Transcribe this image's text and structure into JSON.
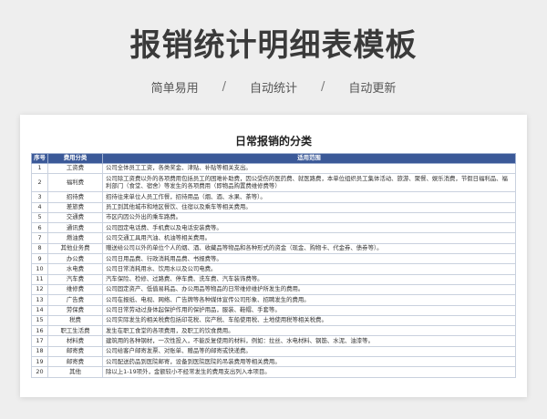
{
  "page": {
    "title": "报销统计明细表模板",
    "tagline": [
      "简单易用",
      "/",
      "自动统计",
      "/",
      "自动更新"
    ]
  },
  "sheet": {
    "title": "日常报销的分类",
    "headers": [
      "序号",
      "费用分类",
      "适用范围"
    ],
    "rows": [
      {
        "no": "1",
        "category": "工资费",
        "scope": "公司全体员工工资，各类奖金、津贴、补贴等相关支出。"
      },
      {
        "no": "2",
        "category": "福利费",
        "scope": "公司除工资费以外的各项费用包括员工的困难补助费，因公受伤的医药费、就医路费，本单位组织员工集体活动、旅游、聚餐、娱乐消费，节假日福利品、福利部门（食堂、宿舍）等发生的各项费用（即物品购置费维修费等）"
      },
      {
        "no": "3",
        "category": "招待费",
        "scope": "招待往来单位人员工作餐，招待用品（烟、酒、水果、茶等）。"
      },
      {
        "no": "4",
        "category": "差旅费",
        "scope": "员工到其他城市和地区餐饮、住宿以及乘车等相关费用。"
      },
      {
        "no": "5",
        "category": "交通费",
        "scope": "市区内因公外出的乘车路费。"
      },
      {
        "no": "6",
        "category": "通讯费",
        "scope": "公司固定电话费、手机费以及电话安装费等。"
      },
      {
        "no": "7",
        "category": "燃油费",
        "scope": "公司交通工具用汽油、机油等相关费用。"
      },
      {
        "no": "8",
        "category": "其他业务费",
        "scope": "赠送给公司以外的单位个人的烟、酒、收藏品等物品和各种形式的资金（现金、购物卡、代金券、债券等）。"
      },
      {
        "no": "9",
        "category": "办公费",
        "scope": "公司日用品费、行政消耗用品费、书报费等。"
      },
      {
        "no": "10",
        "category": "水电费",
        "scope": "公司日常消耗用水、饮用水以及公司电费。"
      },
      {
        "no": "11",
        "category": "汽车费",
        "scope": "汽车保险、检修、过路费、停车费、洗车费、汽车装饰费等。"
      },
      {
        "no": "12",
        "category": "维修费",
        "scope": "公司固定资产、低值易耗品、办公用品等物品的日常维修维护所发生的费用。"
      },
      {
        "no": "13",
        "category": "广告费",
        "scope": "公司在报纸、电视、网络、广告牌等各种媒体宣传公司形象、招聘发生的费用。"
      },
      {
        "no": "14",
        "category": "劳保费",
        "scope": "公司日常劳动过身体起保护作用的保护用品，服装、鞋帽、手套等。"
      },
      {
        "no": "15",
        "category": "税费",
        "scope": "公司实际发生的相关税费包括印花税、房产税、车船使用税、土地使用税等相关税费。"
      },
      {
        "no": "16",
        "category": "职工生活费",
        "scope": "发生在职工食堂的各项费用，及职工的饮食费用。"
      },
      {
        "no": "17",
        "category": "材料费",
        "scope": "建筑用的各种钢材，一次性投入，不能反复使用的材料，例如：拉丝、水电材料、钢筋、水泥、油漆等。"
      },
      {
        "no": "18",
        "category": "邮寄费",
        "scope": "公司给客户邮寄发票、对账单、赠品等的邮寄或快递费。"
      },
      {
        "no": "19",
        "category": "邮寄费",
        "scope": "公司配送药品到医院邮寄，设备到医院医院的吊装费用等相关费用。"
      },
      {
        "no": "20",
        "category": "其他",
        "scope": "除以上1-19项外，金额较小不经常发生的费用支出列入本项目。"
      }
    ]
  },
  "colors": {
    "header_bg": "#3b5998",
    "page_bg": "#eeeeee"
  }
}
